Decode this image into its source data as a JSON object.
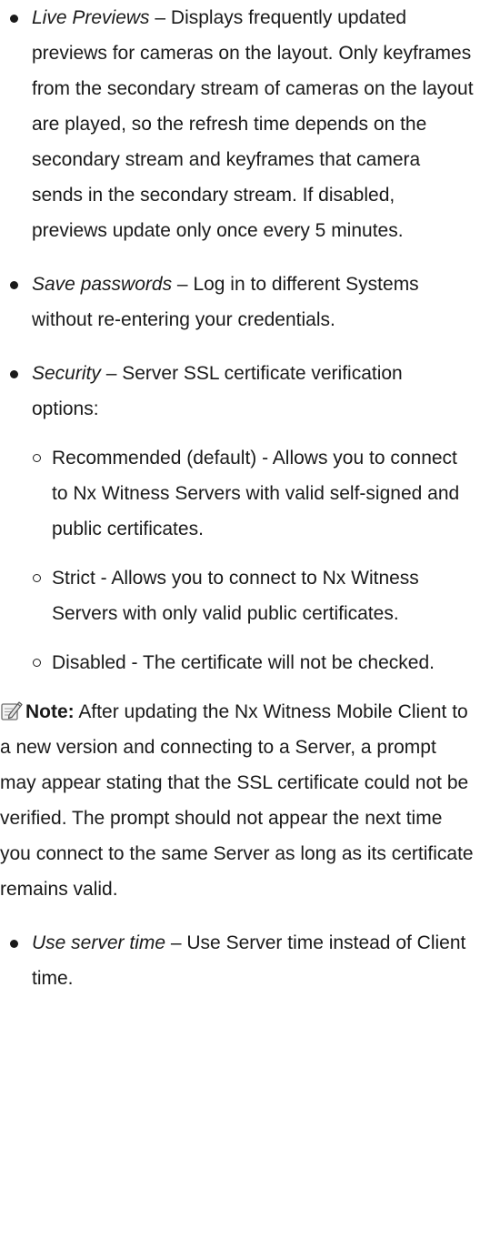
{
  "items": [
    {
      "term": "Live Previews",
      "sep": " – ",
      "text": "Displays frequently updated previews for cameras on the layout. Only keyframes from the secondary stream of cameras on the layout are played, so the refresh time depends on the secondary stream and keyframes that camera sends in the secondary stream. If disabled, previews update only once every 5 minutes."
    },
    {
      "term": "Save passwords",
      "sep": " – ",
      "text": "Log in to different Systems without re-entering your credentials."
    },
    {
      "term": "Security",
      "sep": " – ",
      "text": "Server SSL certificate verification options:"
    },
    {
      "term": "Use server time",
      "sep": " – ",
      "text": "Use Server time instead of Client time."
    }
  ],
  "security_options": [
    "Recommended (default) - Allows you to connect to Nx Witness Servers with valid self-signed and public certificates.",
    "Strict - Allows you to connect to Nx Witness Servers with only valid public certificates.",
    "Disabled - The certificate will not be checked."
  ],
  "note": {
    "icon": "note-pencil-icon",
    "label": "Note:",
    "text": " After updating the Nx Witness Mobile Client to a new version and connecting to a Server, a prompt may appear stating that the SSL certificate could not be verified. The prompt should not appear the next time you connect to the same Server as long as its certificate remains valid."
  }
}
